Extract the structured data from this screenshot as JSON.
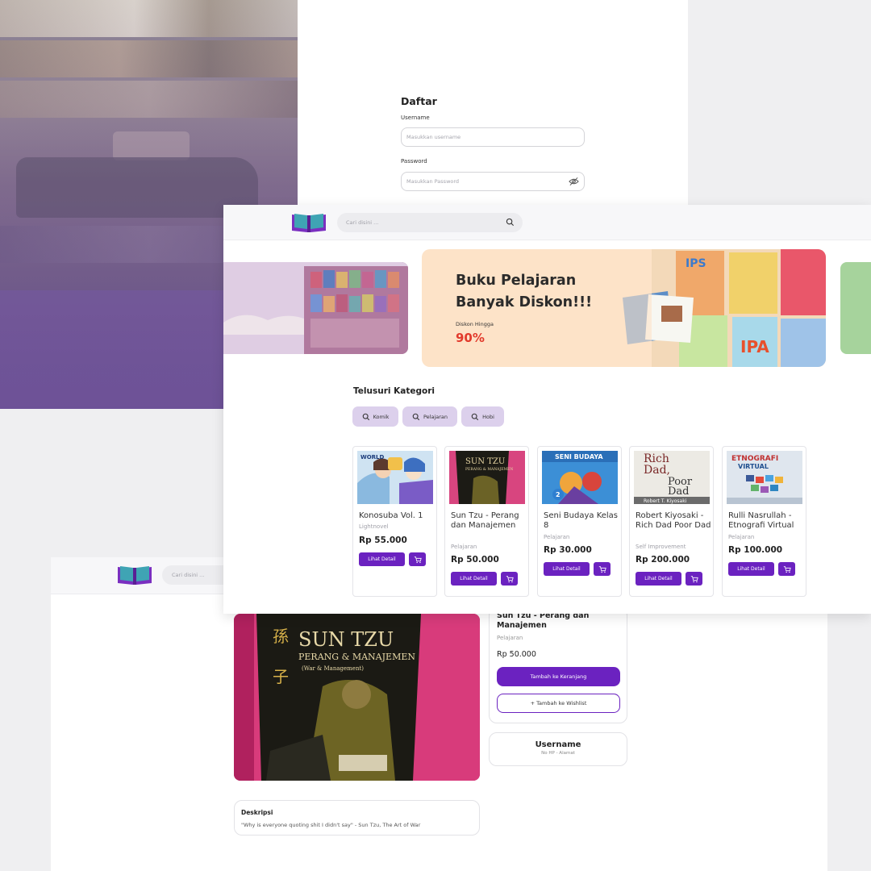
{
  "register": {
    "title": "Daftar",
    "username_label": "Username",
    "username_placeholder": "Masukkan username",
    "password_label": "Password",
    "password_placeholder": "Masukkan Password"
  },
  "home": {
    "search_placeholder": "Cari disini ...",
    "banner": {
      "title_line1": "Buku Pelajaran",
      "title_line2": "Banyak Diskon!!!",
      "subtitle": "Diskon Hingga",
      "percent": "90%"
    },
    "categories_heading": "Telusuri Kategori",
    "categories": [
      "Komik",
      "Pelajaran",
      "Hobi"
    ],
    "products": [
      {
        "title": "Konosuba Vol. 1",
        "category": "Lightnovel",
        "price": "Rp 55.000",
        "detail": "Lihat Detail",
        "lines": 1
      },
      {
        "title": "Sun Tzu - Perang dan Manajemen",
        "category": "Pelajaran",
        "price": "Rp 50.000",
        "detail": "Lihat Detail",
        "lines": 3
      },
      {
        "title": "Seni Budaya Kelas 8",
        "category": "Pelajaran",
        "price": "Rp 30.000",
        "detail": "Lihat Detail",
        "lines": 2
      },
      {
        "title": "Robert Kiyosaki - Rich Dad Poor Dad",
        "category": "Self Improvement",
        "price": "Rp 200.000",
        "detail": "Lihat Detail",
        "lines": 3
      },
      {
        "title": "Rulli Nasrullah - Etnografi Virtual",
        "category": "Pelajaran",
        "price": "Rp 100.000",
        "detail": "Lihat Detail",
        "lines": 2
      }
    ]
  },
  "detail": {
    "search_placeholder": "Cari disini ...",
    "title": "Sun Tzu - Perang dan Manajemen",
    "category": "Pelajaran",
    "price": "Rp 50.000",
    "add_to_cart": "Tambah ke Keranjang",
    "add_to_wishlist": "+ Tambah ke Wishlist",
    "seller_name": "Username",
    "seller_sub": "No HP - Alamat",
    "description_title": "Deskripsi",
    "description_text": "\"Why is everyone quoting shit I didn't say\" - Sun Tzu, The Art of War",
    "cover_text": [
      "SUN TZU",
      "PERANG & MANAJEMEN",
      "(War & Management)"
    ]
  },
  "colors": {
    "accent": "#6b22c0",
    "category_bg": "#dcd0ec",
    "banner_bg": "#fde3c8",
    "discount": "#e23a2c"
  }
}
